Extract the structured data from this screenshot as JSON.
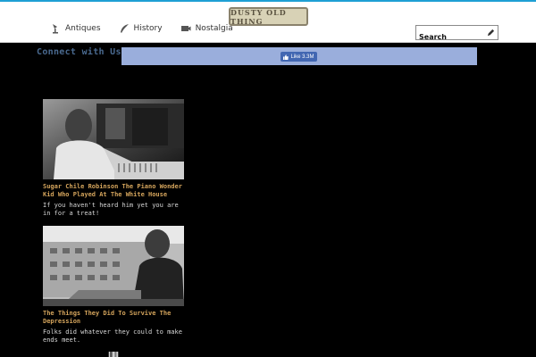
{
  "header": {
    "logo_text": "DUSTY OLD THING",
    "nav": [
      {
        "label": "Antiques",
        "icon": "lamp-icon"
      },
      {
        "label": "History",
        "icon": "quill-icon"
      },
      {
        "label": "Nostalgia",
        "icon": "projector-icon"
      }
    ],
    "search": {
      "placeholder": "Search",
      "icon": "pencil-icon"
    }
  },
  "social": {
    "connect_label": "Connect with Us",
    "like_label": "Like 3.3M"
  },
  "articles": [
    {
      "title": "Sugar Chile Robinson The Piano Wonder Kid Who Played At The White House",
      "description": "If you haven't heard him yet you are in for a treat!"
    },
    {
      "title": "The Things They Did To Survive The Depression",
      "description": "Folks did whatever they could to make ends meet."
    }
  ],
  "colors": {
    "accent_line": "#1e9fd4",
    "title_text": "#d4a45c",
    "fb_bar": "#9aaedc",
    "fb_button": "#4267b2"
  }
}
